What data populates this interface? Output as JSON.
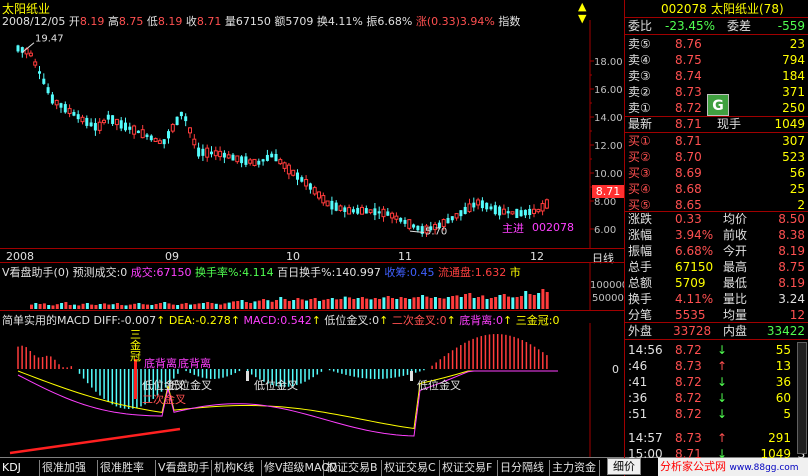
{
  "title": "太阳纸业",
  "header": {
    "date": "2008/12/05",
    "open_label": "开",
    "open": "8.19",
    "high_label": "高",
    "high": "8.75",
    "low_label": "低",
    "low": "8.19",
    "close_label": "收",
    "close": "8.71",
    "vol_label": "量",
    "vol": "67150",
    "amt_label": "额",
    "amt": "5709",
    "turn_label": "换",
    "turn": "4.11%",
    "amp_label": "振",
    "amp": "6.68%",
    "chg_label": "涨",
    "chg": "(0.33)3.94%",
    "idx_label": "指数"
  },
  "price_axis": [
    "18.00",
    "16.00",
    "14.00",
    "12.00",
    "10.00",
    "8.00",
    "6.00"
  ],
  "price_tag": "8.71",
  "annot": {
    "max": "19.47",
    "min": "5.70",
    "zhujin": "主进",
    "code": "002078"
  },
  "x_axis": [
    "2008",
    "09",
    "10",
    "11",
    "12"
  ],
  "x_axis_right": "日线",
  "vol": {
    "title": "V看盘助手(0)",
    "items": [
      {
        "l": "预测成交:0",
        "c": "#e0e0e0"
      },
      {
        "l": "成交:67150",
        "c": "#ff40ff"
      },
      {
        "l": "换手率%:4.114",
        "c": "#50ff50"
      },
      {
        "l": "百日换手%:140.997",
        "c": "#e0e0e0"
      },
      {
        "l": "收筹:0.45",
        "c": "#4060ff"
      },
      {
        "l": "流通盘:1.632",
        "c": "#ff4040"
      },
      {
        "l": "市",
        "c": "#ffff00"
      }
    ],
    "axis": [
      "100000",
      "50000"
    ],
    "bars": [
      0.22,
      0.3,
      0.25,
      0.28,
      0.2,
      0.18,
      0.24,
      0.3,
      0.35,
      0.2,
      0.22,
      0.18,
      0.26,
      0.3,
      0.22,
      0.2,
      0.25,
      0.28,
      0.22,
      0.24,
      0.3,
      0.2,
      0.18,
      0.22,
      0.26,
      0.3,
      0.24,
      0.22,
      0.2,
      0.25,
      0.3,
      0.35,
      0.28,
      0.22,
      0.2,
      0.26,
      0.3,
      0.22,
      0.24,
      0.28,
      0.3,
      0.35,
      0.3,
      0.26,
      0.22,
      0.28,
      0.32,
      0.38,
      0.4,
      0.45,
      0.35,
      0.3,
      0.38,
      0.42,
      0.5,
      0.44,
      0.36,
      0.45,
      0.6,
      0.5,
      0.4,
      0.45,
      0.55,
      0.48,
      0.42,
      0.5,
      0.55,
      0.4,
      0.46,
      0.5,
      0.55,
      0.48,
      0.5,
      0.62,
      0.58,
      0.5,
      0.55,
      0.6,
      0.52,
      0.48,
      0.55,
      0.5,
      0.58,
      0.65,
      0.55,
      0.5,
      0.6,
      0.55,
      0.5,
      0.58,
      0.6,
      0.7,
      0.62,
      0.55,
      0.6,
      0.55,
      0.52,
      0.6,
      0.65,
      0.68,
      0.6,
      0.75,
      0.8,
      0.55,
      0.6,
      0.68,
      0.5,
      0.55,
      0.6,
      0.7,
      0.75,
      0.62,
      0.58,
      0.6,
      0.65,
      0.9,
      0.75,
      0.7,
      0.8,
      1.0,
      0.85
    ]
  },
  "macd": {
    "title": "简单实用的MACD",
    "diff": "DIFF:-0.007",
    "dea": "DEA:-0.278",
    "macd": "MACD:0.542",
    "jc1": "低位金叉:0",
    "jc2": "二次金叉:0",
    "dbl": "底背离:0",
    "sgg": "三金冠:0",
    "axis_zero": "0",
    "sgg_txt": "三金冠",
    "dbl_txt": "底背离",
    "dbl2": "底背离",
    "dwjc": "低位金叉",
    "ecjc": "二次金叉"
  },
  "tabs": [
    "KDJ",
    "很准加强",
    "很准胜率",
    "V看盘助手",
    "机构K线",
    "修V超级MACD",
    "权证交易B",
    "权证交易C",
    "权证交易F",
    "日分隔线",
    "主力资金"
  ],
  "brand": "分析家公式网",
  "brand_url": "www.88gg.com",
  "panel": {
    "code": "002078",
    "name": "太阳纸业(78)",
    "wb_label": "委比",
    "wb": "-23.45%",
    "wc_label": "委差",
    "wc": "-559",
    "asks": [
      {
        "l": "卖⑤",
        "p": "8.76",
        "v": "23"
      },
      {
        "l": "卖④",
        "p": "8.75",
        "v": "794"
      },
      {
        "l": "卖③",
        "p": "8.74",
        "v": "184"
      },
      {
        "l": "卖②",
        "p": "8.73",
        "v": "371"
      },
      {
        "l": "卖①",
        "p": "8.72",
        "v": "250"
      }
    ],
    "last_label": "最新",
    "last": "8.71",
    "cur_label": "现手",
    "cur": "1049",
    "bids": [
      {
        "l": "买①",
        "p": "8.71",
        "v": "307"
      },
      {
        "l": "买②",
        "p": "8.70",
        "v": "523"
      },
      {
        "l": "买③",
        "p": "8.69",
        "v": "56"
      },
      {
        "l": "买④",
        "p": "8.68",
        "v": "25"
      },
      {
        "l": "买⑤",
        "p": "8.65",
        "v": "2"
      }
    ],
    "stats": [
      {
        "a": "涨跌",
        "b": "0.33",
        "c": "均价",
        "d": "8.50"
      },
      {
        "a": "涨幅",
        "b": "3.94%",
        "c": "前收",
        "d": "8.38"
      },
      {
        "a": "振幅",
        "b": "6.68%",
        "c": "今开",
        "d": "8.19"
      },
      {
        "a": "总手",
        "b": "67150",
        "c": "最高",
        "d": "8.75"
      },
      {
        "a": "总额",
        "b": "5709",
        "c": "最低",
        "d": "8.19"
      },
      {
        "a": "换手",
        "b": "4.11%",
        "c": "量比",
        "d": "3.24"
      },
      {
        "a": "分笔",
        "b": "5535",
        "c": "均量",
        "d": "12"
      }
    ],
    "wp_label": "外盘",
    "wp": "33728",
    "np_label": "内盘",
    "np": "33422",
    "ticks": [
      {
        "t": "14:56",
        "p": "8.72",
        "v": "55",
        "f": "S"
      },
      {
        "t": ":46",
        "p": "8.73",
        "v": "13",
        "f": "B"
      },
      {
        "t": ":41",
        "p": "8.72",
        "v": "36",
        "f": "S"
      },
      {
        "t": ":36",
        "p": "8.72",
        "v": "60",
        "f": "S"
      },
      {
        "t": ":51",
        "p": "8.72",
        "v": "5",
        "f": "S"
      },
      {
        "t": "14:57",
        "p": "8.73",
        "v": "291",
        "f": "B"
      },
      {
        "t": "15:00",
        "p": "8.71",
        "v": "1049",
        "f": "S"
      }
    ],
    "btn": "细价",
    "g": "G"
  }
}
